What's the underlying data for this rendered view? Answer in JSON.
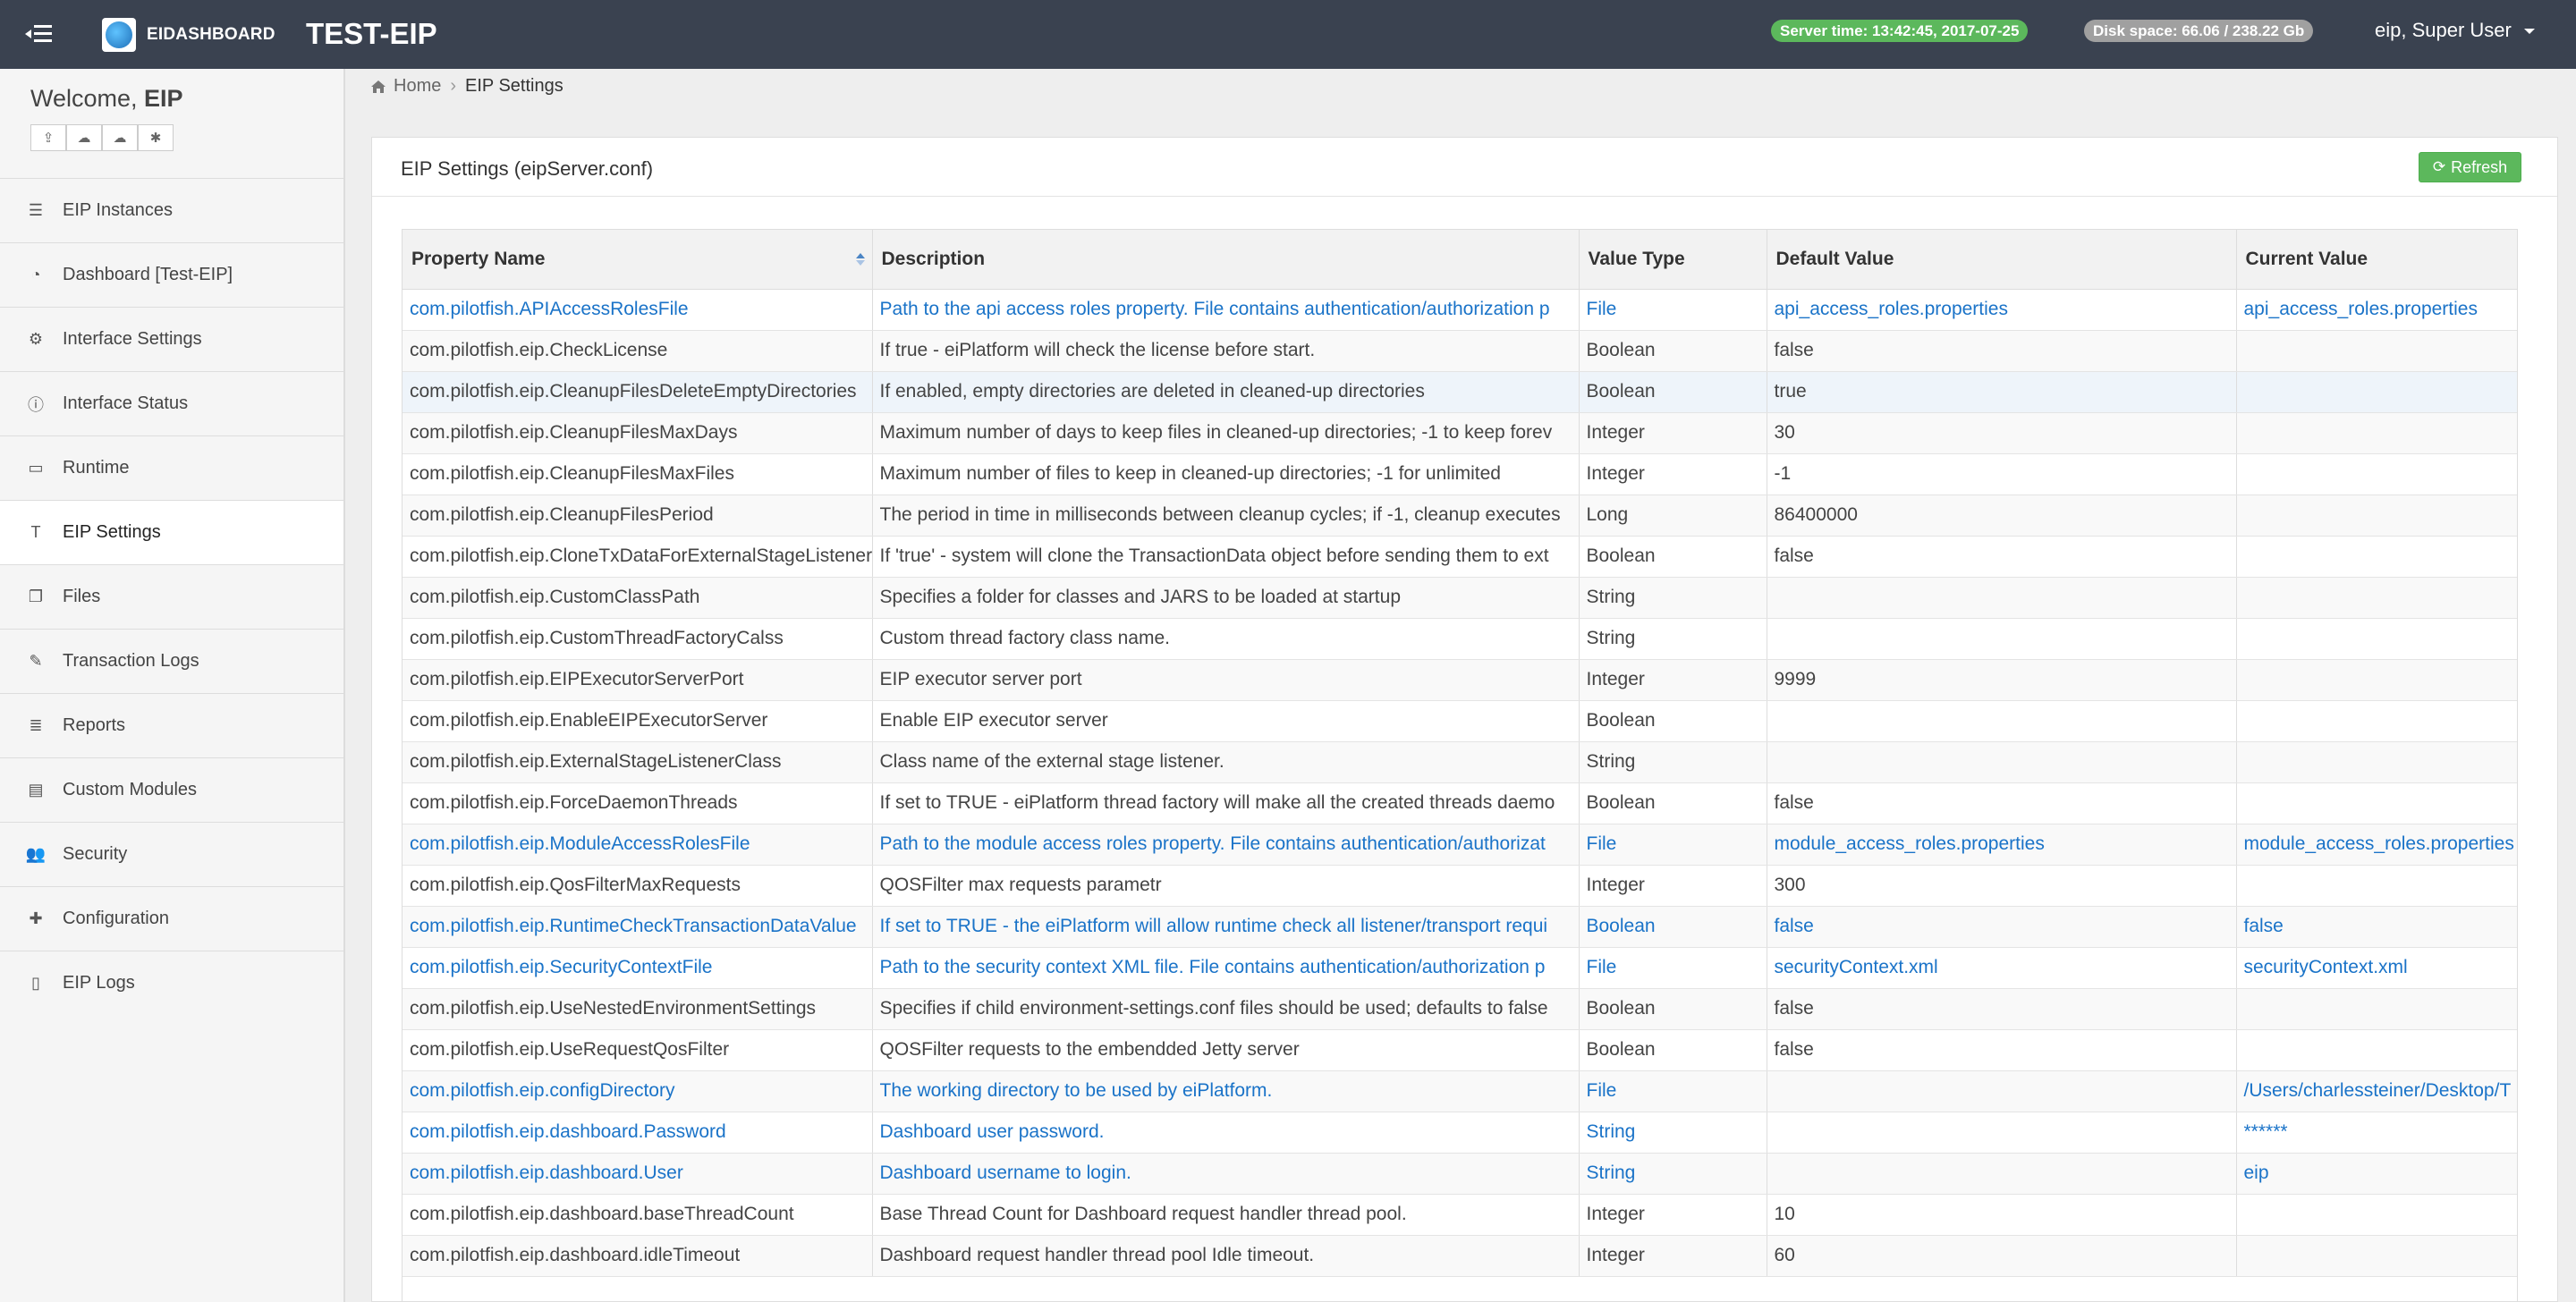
{
  "header": {
    "logo_text": "EIDASHBOARD",
    "env_title": "TEST-EIP",
    "server_time": "Server time: 13:42:45, 2017-07-25",
    "disk_space": "Disk space: 66.06 / 238.22 Gb",
    "user": "eip, Super User"
  },
  "sidebar": {
    "welcome_prefix": "Welcome, ",
    "welcome_name": "EIP",
    "items": [
      {
        "label": "EIP Instances",
        "icon": "server-icon",
        "glyph": "☰"
      },
      {
        "label": "Dashboard [Test-EIP]",
        "icon": "dashboard-icon",
        "glyph": "◔"
      },
      {
        "label": "Interface Settings",
        "icon": "cogs-icon",
        "glyph": "⚙"
      },
      {
        "label": "Interface Status",
        "icon": "info-icon",
        "glyph": "ⓘ"
      },
      {
        "label": "Runtime",
        "icon": "monitor-icon",
        "glyph": "▭"
      },
      {
        "label": "EIP Settings",
        "icon": "text-icon",
        "glyph": "T"
      },
      {
        "label": "Files",
        "icon": "files-icon",
        "glyph": "❐"
      },
      {
        "label": "Transaction Logs",
        "icon": "edit-icon",
        "glyph": "✎"
      },
      {
        "label": "Reports",
        "icon": "list-icon",
        "glyph": "≣"
      },
      {
        "label": "Custom Modules",
        "icon": "modules-icon",
        "glyph": "▤"
      },
      {
        "label": "Security",
        "icon": "users-icon",
        "glyph": "👥"
      },
      {
        "label": "Configuration",
        "icon": "puzzle-icon",
        "glyph": "✚"
      },
      {
        "label": "EIP Logs",
        "icon": "file-icon",
        "glyph": "▯"
      }
    ],
    "active_index": 5
  },
  "breadcrumb": {
    "home": "Home",
    "current": "EIP Settings"
  },
  "panel": {
    "title": "EIP Settings (eipServer.conf)",
    "refresh_label": "Refresh"
  },
  "table": {
    "columns": [
      "Property Name",
      "Description",
      "Value Type",
      "Default Value",
      "Current Value"
    ],
    "rows": [
      {
        "name": "com.pilotfish.APIAccessRolesFile",
        "desc": "Path to the api access roles property. File contains authentication/authorization p",
        "type": "File",
        "default": "api_access_roles.properties",
        "current": "api_access_roles.properties",
        "highlight": true
      },
      {
        "name": "com.pilotfish.eip.CheckLicense",
        "desc": "If true - eiPlatform will check the license before start.",
        "type": "Boolean",
        "default": "false",
        "current": "",
        "highlight": false
      },
      {
        "name": "com.pilotfish.eip.CleanupFilesDeleteEmptyDirectories",
        "desc": "If enabled, empty directories are deleted in cleaned-up directories",
        "type": "Boolean",
        "default": "true",
        "current": "",
        "highlight": false
      },
      {
        "name": "com.pilotfish.eip.CleanupFilesMaxDays",
        "desc": "Maximum number of days to keep files in cleaned-up directories; -1 to keep forev",
        "type": "Integer",
        "default": "30",
        "current": "",
        "highlight": false
      },
      {
        "name": "com.pilotfish.eip.CleanupFilesMaxFiles",
        "desc": "Maximum number of files to keep in cleaned-up directories; -1 for unlimited",
        "type": "Integer",
        "default": "-1",
        "current": "",
        "highlight": false
      },
      {
        "name": "com.pilotfish.eip.CleanupFilesPeriod",
        "desc": "The period in time in milliseconds between cleanup cycles; if -1, cleanup executes",
        "type": "Long",
        "default": "86400000",
        "current": "",
        "highlight": false
      },
      {
        "name": "com.pilotfish.eip.CloneTxDataForExternalStageListener",
        "desc": "If 'true' - system will clone the TransactionData object before sending them to ext",
        "type": "Boolean",
        "default": "false",
        "current": "",
        "highlight": false
      },
      {
        "name": "com.pilotfish.eip.CustomClassPath",
        "desc": "Specifies a folder for classes and JARS to be loaded at startup",
        "type": "String",
        "default": "",
        "current": "",
        "highlight": false
      },
      {
        "name": "com.pilotfish.eip.CustomThreadFactoryCalss",
        "desc": "Custom thread factory class name.",
        "type": "String",
        "default": "",
        "current": "",
        "highlight": false
      },
      {
        "name": "com.pilotfish.eip.EIPExecutorServerPort",
        "desc": "EIP executor server port",
        "type": "Integer",
        "default": "9999",
        "current": "",
        "highlight": false
      },
      {
        "name": "com.pilotfish.eip.EnableEIPExecutorServer",
        "desc": "Enable EIP executor server",
        "type": "Boolean",
        "default": "",
        "current": "",
        "highlight": false
      },
      {
        "name": "com.pilotfish.eip.ExternalStageListenerClass",
        "desc": "Class name of the external stage listener.",
        "type": "String",
        "default": "",
        "current": "",
        "highlight": false
      },
      {
        "name": "com.pilotfish.eip.ForceDaemonThreads",
        "desc": "If set to TRUE - eiPlatform thread factory will make all the created threads daemo",
        "type": "Boolean",
        "default": "false",
        "current": "",
        "highlight": false
      },
      {
        "name": "com.pilotfish.eip.ModuleAccessRolesFile",
        "desc": "Path to the module access roles property. File contains authentication/authorizat",
        "type": "File",
        "default": "module_access_roles.properties",
        "current": "module_access_roles.properties",
        "highlight": true
      },
      {
        "name": "com.pilotfish.eip.QosFilterMaxRequests",
        "desc": "QOSFilter max requests parametr",
        "type": "Integer",
        "default": "300",
        "current": "",
        "highlight": false
      },
      {
        "name": "com.pilotfish.eip.RuntimeCheckTransactionDataValue",
        "desc": "If set to TRUE - the eiPlatform will allow runtime check all listener/transport requi",
        "type": "Boolean",
        "default": "false",
        "current": "false",
        "highlight": true
      },
      {
        "name": "com.pilotfish.eip.SecurityContextFile",
        "desc": "Path to the security context XML file. File contains authentication/authorization p",
        "type": "File",
        "default": "securityContext.xml",
        "current": "securityContext.xml",
        "highlight": true
      },
      {
        "name": "com.pilotfish.eip.UseNestedEnvironmentSettings",
        "desc": "Specifies if child environment-settings.conf files should be used; defaults to false",
        "type": "Boolean",
        "default": "false",
        "current": "",
        "highlight": false
      },
      {
        "name": "com.pilotfish.eip.UseRequestQosFilter",
        "desc": "QOSFilter requests to the embendded Jetty server",
        "type": "Boolean",
        "default": "false",
        "current": "",
        "highlight": false
      },
      {
        "name": "com.pilotfish.eip.configDirectory",
        "desc": "The working directory to be used by eiPlatform.",
        "type": "File",
        "default": "",
        "current": "/Users/charlessteiner/Desktop/T",
        "highlight": true
      },
      {
        "name": "com.pilotfish.eip.dashboard.Password",
        "desc": "Dashboard user password.",
        "type": "String",
        "default": "",
        "current": "******",
        "highlight": true
      },
      {
        "name": "com.pilotfish.eip.dashboard.User",
        "desc": "Dashboard username to login.",
        "type": "String",
        "default": "",
        "current": "eip",
        "highlight": true
      },
      {
        "name": "com.pilotfish.eip.dashboard.baseThreadCount",
        "desc": "Base Thread Count for Dashboard request handler thread pool.",
        "type": "Integer",
        "default": "10",
        "current": "",
        "highlight": false
      },
      {
        "name": "com.pilotfish.eip.dashboard.idleTimeout",
        "desc": "Dashboard request handler thread pool Idle timeout.",
        "type": "Integer",
        "default": "60",
        "current": "",
        "highlight": false
      }
    ]
  }
}
